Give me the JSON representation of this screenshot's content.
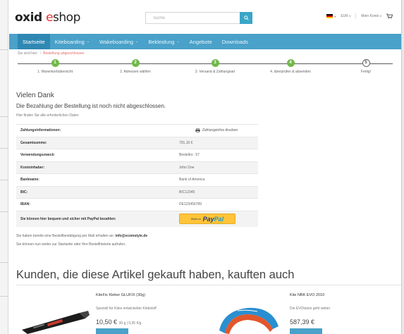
{
  "header": {
    "logo": {
      "part1": "oxid",
      "part2": "e",
      "part3": "shop"
    },
    "search": {
      "placeholder": "Suche",
      "icon": "search-icon"
    },
    "currency": "EUR",
    "account": "Mein Konto",
    "language_flag": "de-flag-icon",
    "cart_icon": "cart-icon"
  },
  "nav": {
    "items": [
      {
        "label": "Startseite",
        "dropdown": false,
        "active": true
      },
      {
        "label": "Kiteboarding",
        "dropdown": true,
        "active": false
      },
      {
        "label": "Wakeboarding",
        "dropdown": true,
        "active": false
      },
      {
        "label": "Bekleidung",
        "dropdown": true,
        "active": false
      },
      {
        "label": "Angebote",
        "dropdown": false,
        "active": false
      },
      {
        "label": "Downloads",
        "dropdown": false,
        "active": false
      }
    ]
  },
  "breadcrumb": {
    "prefix": "Sie sind hier:",
    "separator": "/",
    "current": "Bestellung abgeschlossen"
  },
  "steps": [
    {
      "number": "1",
      "label": "1. Warenkorbübersicht"
    },
    {
      "number": "2",
      "label": "2. Adressen wählen"
    },
    {
      "number": "3",
      "label": "3. Versand & Zahlungsart"
    },
    {
      "number": "4",
      "label": "4. überprüfen & absenden"
    },
    {
      "number": "5",
      "label": "Fertig!"
    }
  ],
  "thanks": {
    "title": "Vielen Dank",
    "subtitle": "Die Bezahlung der Bestellung ist noch nicht abgeschlossen.",
    "hint": "Hier finden Sie alle erforderlichen Daten"
  },
  "payment": {
    "header_label": "Zahlungsinformationen:",
    "print_label": "Zahlungsinfos drucken",
    "rows": [
      {
        "key": "Gesamtsumme:",
        "value": "791,10 €"
      },
      {
        "key": "Verwendungszweck:",
        "value": "Bestellnr.: 57"
      },
      {
        "key": "Kontoinhaber:",
        "value": "John Doe"
      },
      {
        "key": "Bankname:",
        "value": "Bank of America"
      },
      {
        "key": "BIC:",
        "value": "BIC12345"
      },
      {
        "key": "IBAN:",
        "value": "DE123456789"
      }
    ],
    "paypal_label": "Sie können hier bequem und sicher mit PayPal bezahlen:",
    "paypal_button": {
      "prefix": "Direkt zu",
      "brand_a": "Pay",
      "brand_b": "Pal"
    }
  },
  "mail_note": {
    "text": "Sie haben bereits eine Bestellbestätigung per Mail erhalten an:",
    "email": "info@ecomstyle.de"
  },
  "next_note": "Sie können nun weiter zur Startseite oder Ihre Bestellhistorie aufrufen.",
  "recommendations": {
    "title": "Kunden, die diese Artikel gekauft haben, kauften auch",
    "products": [
      {
        "name": "KiteFix Kleber GLUFIX (30g)",
        "desc": "Speziell für Kites entwickelter Klebstoff",
        "price": "10,50 €",
        "unit_price": "30 g | 0,35 €/g"
      },
      {
        "name": "Kite NBK EVO 2010",
        "desc": "Die EVOlution geht weiter",
        "price": "587,39 €",
        "unit_price": ""
      }
    ]
  },
  "colors": {
    "accent": "#4aa1c9",
    "nav_active": "#2f88b3",
    "step_done": "#72b84a",
    "breadcrumb_link": "#e36b6b",
    "paypal_yellow": "#ffc439"
  }
}
